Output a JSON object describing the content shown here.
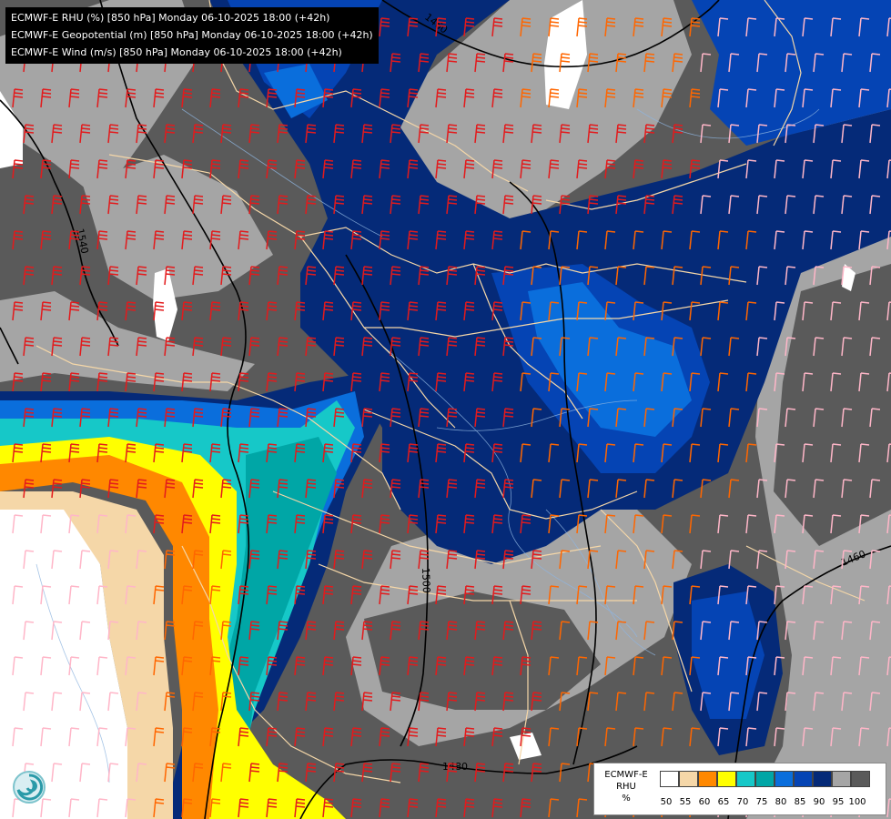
{
  "header": {
    "lines": [
      "ECMWF-E RHU (%) [850 hPa] Monday 06-10-2025 18:00 (+42h)",
      "ECMWF-E Geopotential (m) [850 hPa] Monday 06-10-2025 18:00 (+42h)",
      "ECMWF-E Wind (m/s) [850 hPa] Monday 06-10-2025 18:00 (+42h)"
    ]
  },
  "contours": {
    "labels": [
      "1460",
      "1540",
      "1500",
      "1460",
      "1480"
    ],
    "line_color": "#000000"
  },
  "legend": {
    "title_lines": [
      "ECMWF-E",
      "RHU",
      "%"
    ],
    "ticks": [
      "50",
      "55",
      "60",
      "65",
      "70",
      "75",
      "80",
      "85",
      "90",
      "95",
      "100"
    ],
    "swatch_colors": [
      "#ffffff",
      "#f5d7a8",
      "#ff8800",
      "#ffff00",
      "#16c8c8",
      "#00a6a6",
      "#0a6edc",
      "#0544b4",
      "#052a78",
      "#a5a5a5",
      "#5a5a5a"
    ]
  },
  "colors": {
    "wind_strong": "#e31a1c",
    "wind_moderate": "#ff6600",
    "wind_light": "#ffb6c8",
    "borders": "#f5d7a8",
    "rivers": "#8fb5e0"
  },
  "logo": {
    "icon": "ecmwf-swirl-icon"
  }
}
